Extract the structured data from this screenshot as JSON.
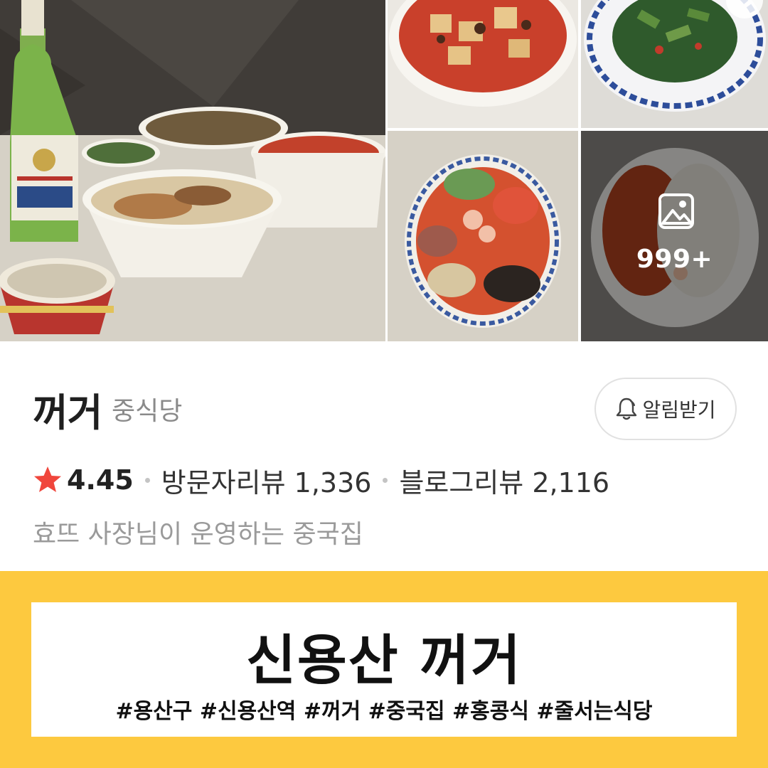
{
  "gallery": {
    "more_count": "999+",
    "icons": {
      "more": "image-icon"
    }
  },
  "place": {
    "name": "꺼거",
    "category": "중식당",
    "rating": "4.45",
    "visitor_reviews": "방문자리뷰 1,336",
    "blog_reviews": "블로그리뷰 2,116",
    "description": "효뜨 사장님이 운영하는 중국집",
    "notify_button_label": "알림받기",
    "icons": {
      "rating": "star-icon",
      "notify": "bell-icon"
    },
    "colors": {
      "star": "#f0463c"
    }
  },
  "caption": {
    "title": "신용산 꺼거",
    "tags": "#용산구 #신용산역 #꺼거 #중국집 #홍콩식 #줄서는식당",
    "colors": {
      "banner": "#fdc93f"
    }
  }
}
